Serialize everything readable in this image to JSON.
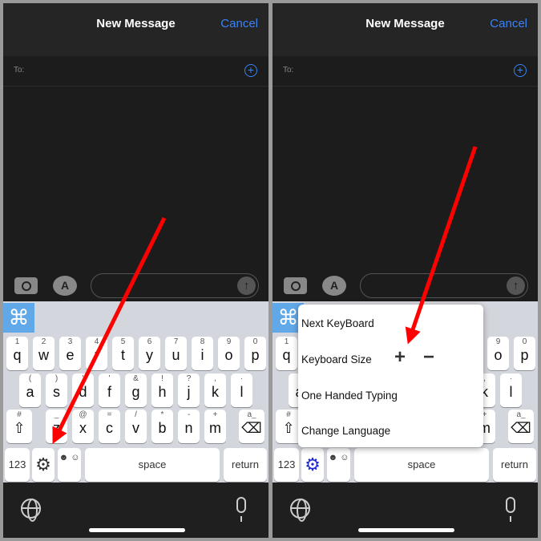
{
  "panels": [
    {
      "title": "New Message",
      "cancel": "Cancel",
      "to_label": "To:",
      "settings_active": false
    },
    {
      "title": "New Message",
      "cancel": "Cancel",
      "to_label": "To:",
      "settings_active": true,
      "popup": {
        "items": [
          "Next KeyBoard",
          "Keyboard Size",
          "One Handed Typing",
          "Change Language"
        ],
        "increase": "+",
        "decrease": "−"
      }
    }
  ],
  "keyboard": {
    "cmd_icon": "⌘",
    "row1": [
      [
        "1",
        "q"
      ],
      [
        "2",
        "w"
      ],
      [
        "3",
        "e"
      ],
      [
        "4",
        "r"
      ],
      [
        "5",
        "t"
      ],
      [
        "6",
        "y"
      ],
      [
        "7",
        "u"
      ],
      [
        "8",
        "i"
      ],
      [
        "9",
        "o"
      ],
      [
        "0",
        "p"
      ]
    ],
    "row2": [
      [
        "(",
        "a"
      ],
      [
        ")",
        "s"
      ],
      [
        "'",
        "d"
      ],
      [
        "'",
        "f"
      ],
      [
        "&",
        "g"
      ],
      [
        "!",
        "h"
      ],
      [
        "?",
        "j"
      ],
      [
        ",",
        "k"
      ],
      [
        "·",
        "l"
      ]
    ],
    "row3": [
      [
        "_",
        "z"
      ],
      [
        "@",
        "x"
      ],
      [
        "=",
        "c"
      ],
      [
        "/",
        "v"
      ],
      [
        "*",
        "b"
      ],
      [
        "-",
        "n"
      ],
      [
        "+",
        "m"
      ]
    ],
    "shift_hint": "#",
    "delete_hint": "a_",
    "numbers": "123",
    "space": "space",
    "return": "return",
    "gear_color_default": "#333333",
    "gear_color_active": "#1e2bd6"
  },
  "colors": {
    "accent": "#3b82f6",
    "arrow": "#ff0000",
    "keyboard_bg": "#d3d6dc"
  }
}
